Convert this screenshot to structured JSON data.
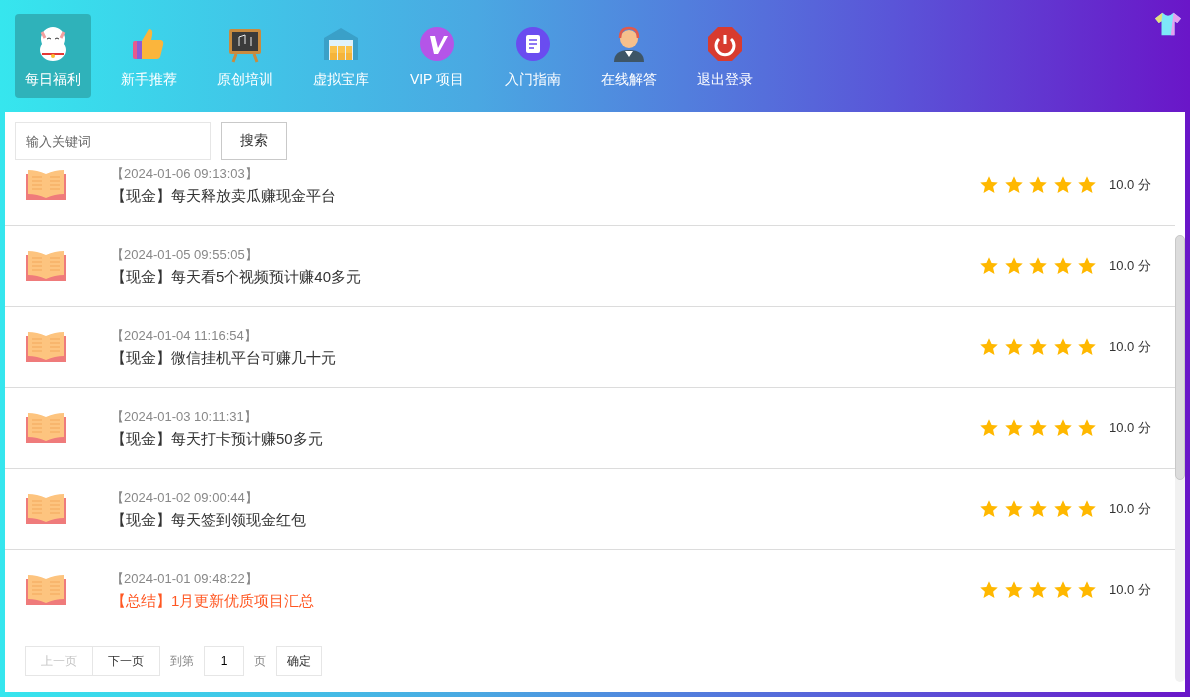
{
  "nav": [
    {
      "label": "每日福利",
      "selected": true
    },
    {
      "label": "新手推荐",
      "selected": false
    },
    {
      "label": "原创培训",
      "selected": false
    },
    {
      "label": "虚拟宝库",
      "selected": false
    },
    {
      "label": "VIP 项目",
      "selected": false
    },
    {
      "label": "入门指南",
      "selected": false
    },
    {
      "label": "在线解答",
      "selected": false
    },
    {
      "label": "退出登录",
      "selected": false
    }
  ],
  "search": {
    "placeholder": "输入关键词",
    "button": "搜索"
  },
  "rows": [
    {
      "date": "【2024-01-06 09:13:03】",
      "title": "【现金】每天释放卖瓜赚现金平台",
      "kind": "normal",
      "stars": 5,
      "score": "10.0 分"
    },
    {
      "date": "【2024-01-05 09:55:05】",
      "title": "【现金】每天看5个视频预计赚40多元",
      "kind": "normal",
      "stars": 5,
      "score": "10.0 分"
    },
    {
      "date": "【2024-01-04 11:16:54】",
      "title": "【现金】微信挂机平台可赚几十元",
      "kind": "normal",
      "stars": 5,
      "score": "10.0 分"
    },
    {
      "date": "【2024-01-03 10:11:31】",
      "title": "【现金】每天打卡预计赚50多元",
      "kind": "normal",
      "stars": 5,
      "score": "10.0 分"
    },
    {
      "date": "【2024-01-02 09:00:44】",
      "title": "【现金】每天签到领现金红包",
      "kind": "normal",
      "stars": 5,
      "score": "10.0 分"
    },
    {
      "date": "【2024-01-01 09:48:22】",
      "title": "【总结】1月更新优质项目汇总",
      "kind": "highlight",
      "stars": 5,
      "score": "10.0 分"
    }
  ],
  "pager": {
    "prev": {
      "label": "上一页",
      "disabled": true
    },
    "next": {
      "label": "下一页",
      "disabled": false
    },
    "goto": "到第",
    "page": "1",
    "unit": "页",
    "confirm": "确定"
  }
}
